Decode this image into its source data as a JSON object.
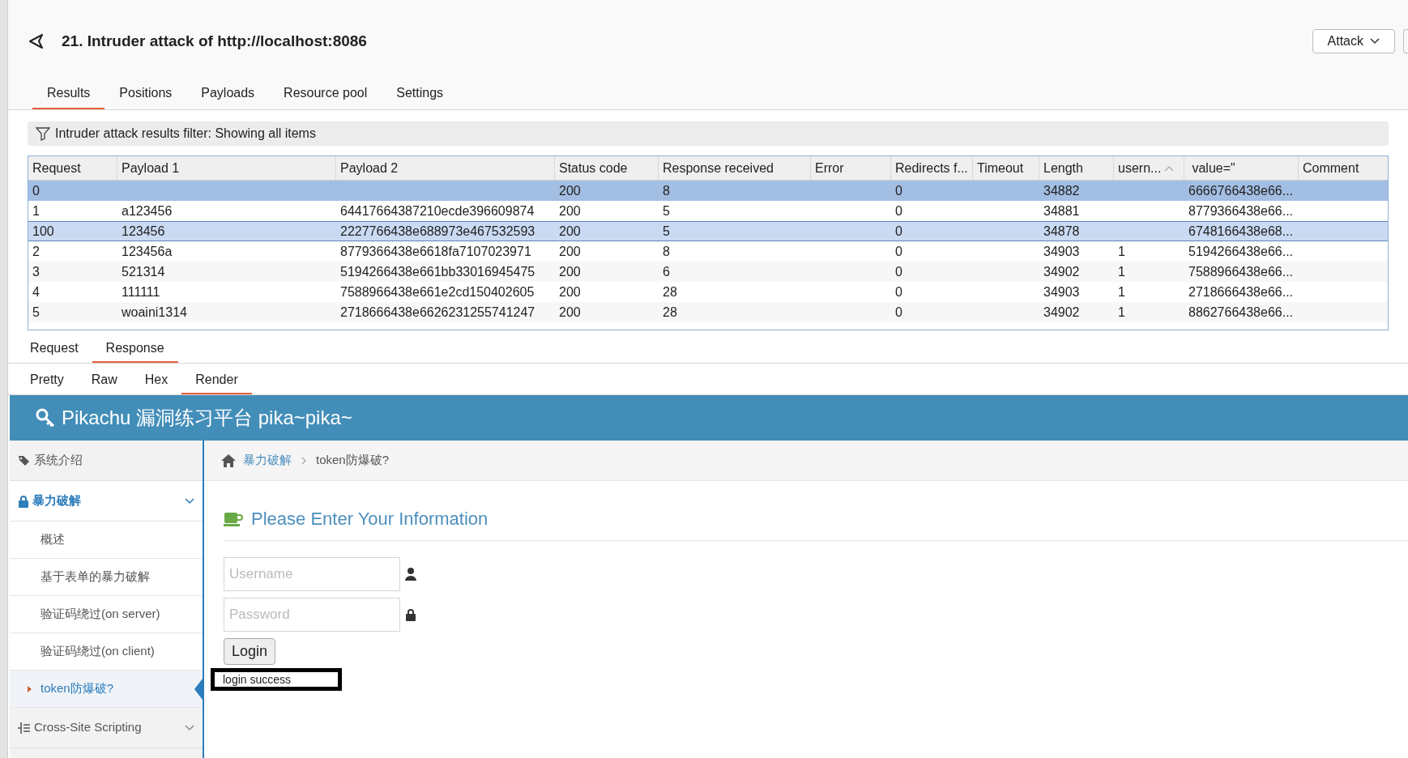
{
  "window": {
    "title": "21. Intruder attack of http://localhost:8086",
    "action_button": "Attack"
  },
  "tabs": [
    {
      "label": "Results",
      "selected": true
    },
    {
      "label": "Positions",
      "selected": false
    },
    {
      "label": "Payloads",
      "selected": false
    },
    {
      "label": "Resource pool",
      "selected": false
    },
    {
      "label": "Settings",
      "selected": false
    }
  ],
  "filter": {
    "text": "Intruder attack results filter: Showing all items"
  },
  "table": {
    "columns": [
      {
        "label": "Request",
        "sorted": false
      },
      {
        "label": "Payload 1",
        "sorted": false
      },
      {
        "label": "Payload 2",
        "sorted": false
      },
      {
        "label": "Status code",
        "sorted": false
      },
      {
        "label": "Response received",
        "sorted": false
      },
      {
        "label": "Error",
        "sorted": false
      },
      {
        "label": "Redirects f...",
        "sorted": false
      },
      {
        "label": "Timeout",
        "sorted": false
      },
      {
        "label": "Length",
        "sorted": false
      },
      {
        "label": "usern...",
        "sorted": true
      },
      {
        "label": " value=\"",
        "sorted": false
      },
      {
        "label": "Comment",
        "sorted": false
      }
    ],
    "rows": [
      {
        "selected": true,
        "focused": false,
        "cells": [
          "0",
          "",
          "",
          "200",
          "8",
          "",
          "0",
          "",
          "34882",
          "",
          "6666766438e66...",
          ""
        ]
      },
      {
        "selected": false,
        "focused": false,
        "cells": [
          "1",
          "a123456",
          "64417664387210ecde396609874",
          "200",
          "5",
          "",
          "0",
          "",
          "34881",
          "",
          "8779366438e66...",
          ""
        ]
      },
      {
        "selected": true,
        "focused": true,
        "cells": [
          "100",
          "123456",
          "2227766438e688973e467532593",
          "200",
          "5",
          "",
          "0",
          "",
          "34878",
          "",
          "6748166438e68...",
          ""
        ]
      },
      {
        "selected": false,
        "focused": false,
        "cells": [
          "2",
          "123456a",
          "8779366438e6618fa7107023971",
          "200",
          "8",
          "",
          "0",
          "",
          "34903",
          "1",
          "5194266438e66...",
          ""
        ]
      },
      {
        "selected": false,
        "focused": false,
        "cells": [
          "3",
          "521314",
          "5194266438e661bb33016945475",
          "200",
          "6",
          "",
          "0",
          "",
          "34902",
          "1",
          "7588966438e66...",
          ""
        ]
      },
      {
        "selected": false,
        "focused": false,
        "cells": [
          "4",
          "111111",
          "7588966438e661e2cd150402605",
          "200",
          "28",
          "",
          "0",
          "",
          "34903",
          "1",
          "2718666438e66...",
          ""
        ]
      },
      {
        "selected": false,
        "focused": false,
        "cells": [
          "5",
          "woaini1314",
          "2718666438e6626231255741247",
          "200",
          "28",
          "",
          "0",
          "",
          "34902",
          "1",
          "8862766438e66...",
          ""
        ]
      }
    ]
  },
  "message_tabs": [
    {
      "label": "Request",
      "selected": false
    },
    {
      "label": "Response",
      "selected": true
    }
  ],
  "view_tabs": [
    {
      "label": "Pretty",
      "selected": false
    },
    {
      "label": "Raw",
      "selected": false
    },
    {
      "label": "Hex",
      "selected": false
    },
    {
      "label": "Render",
      "selected": true
    }
  ],
  "render": {
    "banner": "Pikachu 漏洞练习平台 pika~pika~",
    "sidebar": {
      "items": [
        {
          "label": "系统介绍",
          "active": false
        },
        {
          "label": "暴力破解",
          "expanded": true,
          "active": true,
          "children": [
            {
              "label": "概述",
              "selected": false
            },
            {
              "label": "基于表单的暴力破解",
              "selected": false
            },
            {
              "label": "验证码绕过(on server)",
              "selected": false
            },
            {
              "label": "验证码绕过(on client)",
              "selected": false
            },
            {
              "label": "token防爆破?",
              "selected": true
            }
          ]
        },
        {
          "label": "Cross-Site Scripting",
          "expanded": false,
          "active": false
        }
      ]
    },
    "breadcrumb": [
      {
        "label": "暴力破解",
        "kind": "link"
      },
      {
        "label": "token防爆破?",
        "kind": "current"
      }
    ],
    "form": {
      "heading": "Please Enter Your Information",
      "username": {
        "placeholder": "Username"
      },
      "password": {
        "placeholder": "Password"
      },
      "button": "Login",
      "result": "login success"
    }
  }
}
